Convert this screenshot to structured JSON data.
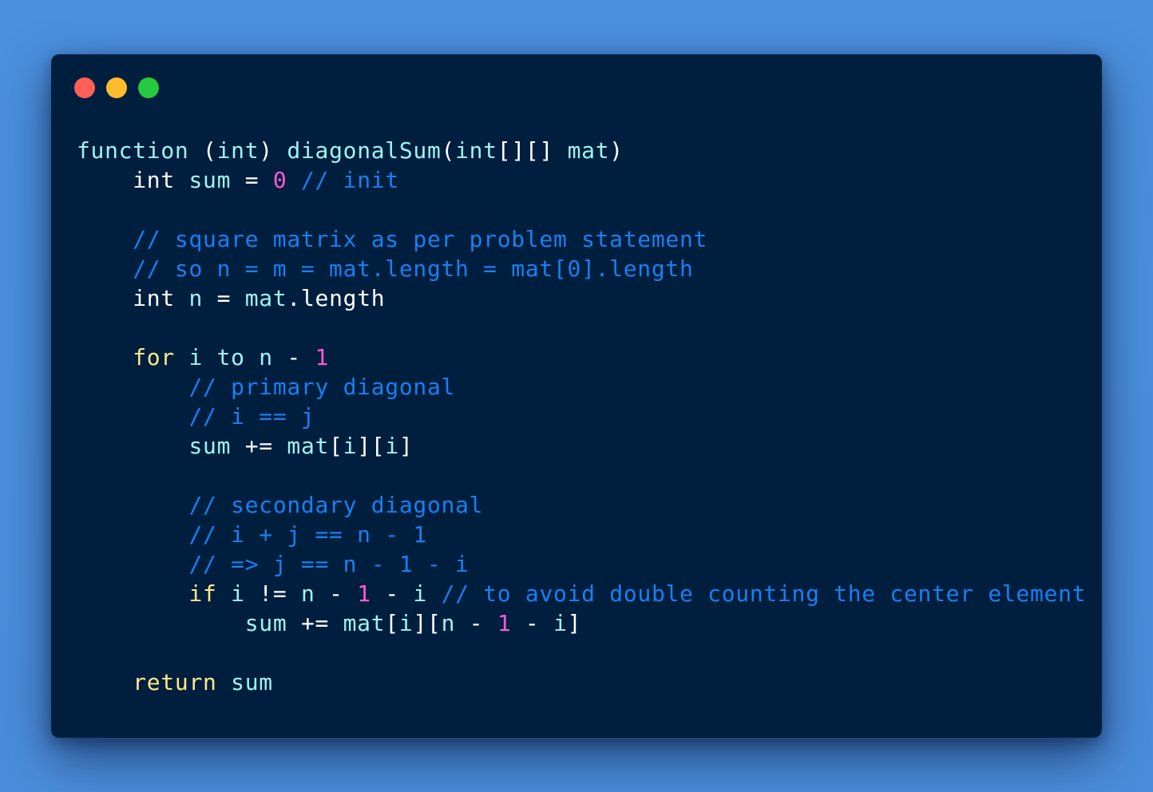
{
  "window": {
    "traffic_lights": [
      {
        "name": "close",
        "color": "#ff5f56"
      },
      {
        "name": "minimize",
        "color": "#ffbd2e"
      },
      {
        "name": "maximize",
        "color": "#27c93f"
      }
    ]
  },
  "colors": {
    "background": "#4a90dd",
    "editor_background": "#001f3f",
    "identifier": "#9ff3f1",
    "plain": "#ffffff",
    "keyword": "#ffe88a",
    "number": "#ff5ad0",
    "comment": "#1a7ff0"
  },
  "code": {
    "lines": [
      [
        {
          "t": "ident",
          "v": "function"
        },
        {
          "t": "plain",
          "v": " ("
        },
        {
          "t": "ident",
          "v": "int"
        },
        {
          "t": "plain",
          "v": ") "
        },
        {
          "t": "ident",
          "v": "diagonalSum"
        },
        {
          "t": "plain",
          "v": "("
        },
        {
          "t": "ident",
          "v": "int"
        },
        {
          "t": "plain",
          "v": "[][] "
        },
        {
          "t": "ident",
          "v": "mat"
        },
        {
          "t": "plain",
          "v": ")"
        }
      ],
      [
        {
          "t": "plain",
          "v": "    int "
        },
        {
          "t": "ident",
          "v": "sum"
        },
        {
          "t": "plain",
          "v": " = "
        },
        {
          "t": "number",
          "v": "0"
        },
        {
          "t": "plain",
          "v": " "
        },
        {
          "t": "comment",
          "v": "// init"
        }
      ],
      [],
      [
        {
          "t": "plain",
          "v": "    "
        },
        {
          "t": "comment",
          "v": "// square matrix as per problem statement"
        }
      ],
      [
        {
          "t": "plain",
          "v": "    "
        },
        {
          "t": "comment",
          "v": "// so n = m = mat.length = mat[0].length"
        }
      ],
      [
        {
          "t": "plain",
          "v": "    int "
        },
        {
          "t": "ident",
          "v": "n"
        },
        {
          "t": "plain",
          "v": " = "
        },
        {
          "t": "ident",
          "v": "mat"
        },
        {
          "t": "plain",
          "v": ".length"
        }
      ],
      [],
      [
        {
          "t": "plain",
          "v": "    "
        },
        {
          "t": "keyword",
          "v": "for"
        },
        {
          "t": "plain",
          "v": " "
        },
        {
          "t": "ident",
          "v": "i"
        },
        {
          "t": "plain",
          "v": " "
        },
        {
          "t": "ident",
          "v": "to"
        },
        {
          "t": "plain",
          "v": " "
        },
        {
          "t": "ident",
          "v": "n"
        },
        {
          "t": "plain",
          "v": " - "
        },
        {
          "t": "number",
          "v": "1"
        }
      ],
      [
        {
          "t": "plain",
          "v": "        "
        },
        {
          "t": "comment",
          "v": "// primary diagonal"
        }
      ],
      [
        {
          "t": "plain",
          "v": "        "
        },
        {
          "t": "comment",
          "v": "// i == j"
        }
      ],
      [
        {
          "t": "plain",
          "v": "        "
        },
        {
          "t": "ident",
          "v": "sum"
        },
        {
          "t": "plain",
          "v": " += "
        },
        {
          "t": "ident",
          "v": "mat"
        },
        {
          "t": "plain",
          "v": "["
        },
        {
          "t": "ident",
          "v": "i"
        },
        {
          "t": "plain",
          "v": "]["
        },
        {
          "t": "ident",
          "v": "i"
        },
        {
          "t": "plain",
          "v": "]"
        }
      ],
      [],
      [
        {
          "t": "plain",
          "v": "        "
        },
        {
          "t": "comment",
          "v": "// secondary diagonal"
        }
      ],
      [
        {
          "t": "plain",
          "v": "        "
        },
        {
          "t": "comment",
          "v": "// i + j == n - 1"
        }
      ],
      [
        {
          "t": "plain",
          "v": "        "
        },
        {
          "t": "comment",
          "v": "// => j == n - 1 - i"
        }
      ],
      [
        {
          "t": "plain",
          "v": "        "
        },
        {
          "t": "keyword",
          "v": "if"
        },
        {
          "t": "plain",
          "v": " "
        },
        {
          "t": "ident",
          "v": "i"
        },
        {
          "t": "plain",
          "v": " != "
        },
        {
          "t": "ident",
          "v": "n"
        },
        {
          "t": "plain",
          "v": " - "
        },
        {
          "t": "number",
          "v": "1"
        },
        {
          "t": "plain",
          "v": " - "
        },
        {
          "t": "ident",
          "v": "i"
        },
        {
          "t": "plain",
          "v": " "
        },
        {
          "t": "comment",
          "v": "// to avoid double counting the center element"
        }
      ],
      [
        {
          "t": "plain",
          "v": "            "
        },
        {
          "t": "ident",
          "v": "sum"
        },
        {
          "t": "plain",
          "v": " += "
        },
        {
          "t": "ident",
          "v": "mat"
        },
        {
          "t": "plain",
          "v": "["
        },
        {
          "t": "ident",
          "v": "i"
        },
        {
          "t": "plain",
          "v": "]["
        },
        {
          "t": "ident",
          "v": "n"
        },
        {
          "t": "plain",
          "v": " - "
        },
        {
          "t": "number",
          "v": "1"
        },
        {
          "t": "plain",
          "v": " - "
        },
        {
          "t": "ident",
          "v": "i"
        },
        {
          "t": "plain",
          "v": "]"
        }
      ],
      [],
      [
        {
          "t": "plain",
          "v": "    "
        },
        {
          "t": "keyword",
          "v": "return"
        },
        {
          "t": "plain",
          "v": " "
        },
        {
          "t": "ident",
          "v": "sum"
        }
      ]
    ]
  }
}
